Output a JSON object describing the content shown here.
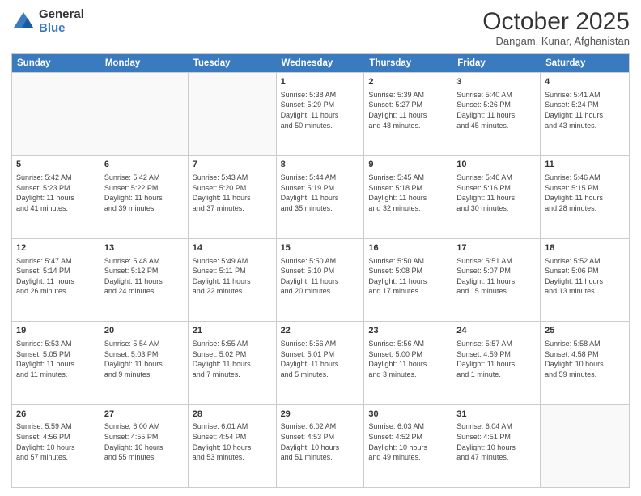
{
  "logo": {
    "general": "General",
    "blue": "Blue"
  },
  "title": "October 2025",
  "location": "Dangam, Kunar, Afghanistan",
  "header_days": [
    "Sunday",
    "Monday",
    "Tuesday",
    "Wednesday",
    "Thursday",
    "Friday",
    "Saturday"
  ],
  "weeks": [
    [
      {
        "day": "",
        "text": ""
      },
      {
        "day": "",
        "text": ""
      },
      {
        "day": "",
        "text": ""
      },
      {
        "day": "1",
        "text": "Sunrise: 5:38 AM\nSunset: 5:29 PM\nDaylight: 11 hours\nand 50 minutes."
      },
      {
        "day": "2",
        "text": "Sunrise: 5:39 AM\nSunset: 5:27 PM\nDaylight: 11 hours\nand 48 minutes."
      },
      {
        "day": "3",
        "text": "Sunrise: 5:40 AM\nSunset: 5:26 PM\nDaylight: 11 hours\nand 45 minutes."
      },
      {
        "day": "4",
        "text": "Sunrise: 5:41 AM\nSunset: 5:24 PM\nDaylight: 11 hours\nand 43 minutes."
      }
    ],
    [
      {
        "day": "5",
        "text": "Sunrise: 5:42 AM\nSunset: 5:23 PM\nDaylight: 11 hours\nand 41 minutes."
      },
      {
        "day": "6",
        "text": "Sunrise: 5:42 AM\nSunset: 5:22 PM\nDaylight: 11 hours\nand 39 minutes."
      },
      {
        "day": "7",
        "text": "Sunrise: 5:43 AM\nSunset: 5:20 PM\nDaylight: 11 hours\nand 37 minutes."
      },
      {
        "day": "8",
        "text": "Sunrise: 5:44 AM\nSunset: 5:19 PM\nDaylight: 11 hours\nand 35 minutes."
      },
      {
        "day": "9",
        "text": "Sunrise: 5:45 AM\nSunset: 5:18 PM\nDaylight: 11 hours\nand 32 minutes."
      },
      {
        "day": "10",
        "text": "Sunrise: 5:46 AM\nSunset: 5:16 PM\nDaylight: 11 hours\nand 30 minutes."
      },
      {
        "day": "11",
        "text": "Sunrise: 5:46 AM\nSunset: 5:15 PM\nDaylight: 11 hours\nand 28 minutes."
      }
    ],
    [
      {
        "day": "12",
        "text": "Sunrise: 5:47 AM\nSunset: 5:14 PM\nDaylight: 11 hours\nand 26 minutes."
      },
      {
        "day": "13",
        "text": "Sunrise: 5:48 AM\nSunset: 5:12 PM\nDaylight: 11 hours\nand 24 minutes."
      },
      {
        "day": "14",
        "text": "Sunrise: 5:49 AM\nSunset: 5:11 PM\nDaylight: 11 hours\nand 22 minutes."
      },
      {
        "day": "15",
        "text": "Sunrise: 5:50 AM\nSunset: 5:10 PM\nDaylight: 11 hours\nand 20 minutes."
      },
      {
        "day": "16",
        "text": "Sunrise: 5:50 AM\nSunset: 5:08 PM\nDaylight: 11 hours\nand 17 minutes."
      },
      {
        "day": "17",
        "text": "Sunrise: 5:51 AM\nSunset: 5:07 PM\nDaylight: 11 hours\nand 15 minutes."
      },
      {
        "day": "18",
        "text": "Sunrise: 5:52 AM\nSunset: 5:06 PM\nDaylight: 11 hours\nand 13 minutes."
      }
    ],
    [
      {
        "day": "19",
        "text": "Sunrise: 5:53 AM\nSunset: 5:05 PM\nDaylight: 11 hours\nand 11 minutes."
      },
      {
        "day": "20",
        "text": "Sunrise: 5:54 AM\nSunset: 5:03 PM\nDaylight: 11 hours\nand 9 minutes."
      },
      {
        "day": "21",
        "text": "Sunrise: 5:55 AM\nSunset: 5:02 PM\nDaylight: 11 hours\nand 7 minutes."
      },
      {
        "day": "22",
        "text": "Sunrise: 5:56 AM\nSunset: 5:01 PM\nDaylight: 11 hours\nand 5 minutes."
      },
      {
        "day": "23",
        "text": "Sunrise: 5:56 AM\nSunset: 5:00 PM\nDaylight: 11 hours\nand 3 minutes."
      },
      {
        "day": "24",
        "text": "Sunrise: 5:57 AM\nSunset: 4:59 PM\nDaylight: 11 hours\nand 1 minute."
      },
      {
        "day": "25",
        "text": "Sunrise: 5:58 AM\nSunset: 4:58 PM\nDaylight: 10 hours\nand 59 minutes."
      }
    ],
    [
      {
        "day": "26",
        "text": "Sunrise: 5:59 AM\nSunset: 4:56 PM\nDaylight: 10 hours\nand 57 minutes."
      },
      {
        "day": "27",
        "text": "Sunrise: 6:00 AM\nSunset: 4:55 PM\nDaylight: 10 hours\nand 55 minutes."
      },
      {
        "day": "28",
        "text": "Sunrise: 6:01 AM\nSunset: 4:54 PM\nDaylight: 10 hours\nand 53 minutes."
      },
      {
        "day": "29",
        "text": "Sunrise: 6:02 AM\nSunset: 4:53 PM\nDaylight: 10 hours\nand 51 minutes."
      },
      {
        "day": "30",
        "text": "Sunrise: 6:03 AM\nSunset: 4:52 PM\nDaylight: 10 hours\nand 49 minutes."
      },
      {
        "day": "31",
        "text": "Sunrise: 6:04 AM\nSunset: 4:51 PM\nDaylight: 10 hours\nand 47 minutes."
      },
      {
        "day": "",
        "text": ""
      }
    ]
  ]
}
